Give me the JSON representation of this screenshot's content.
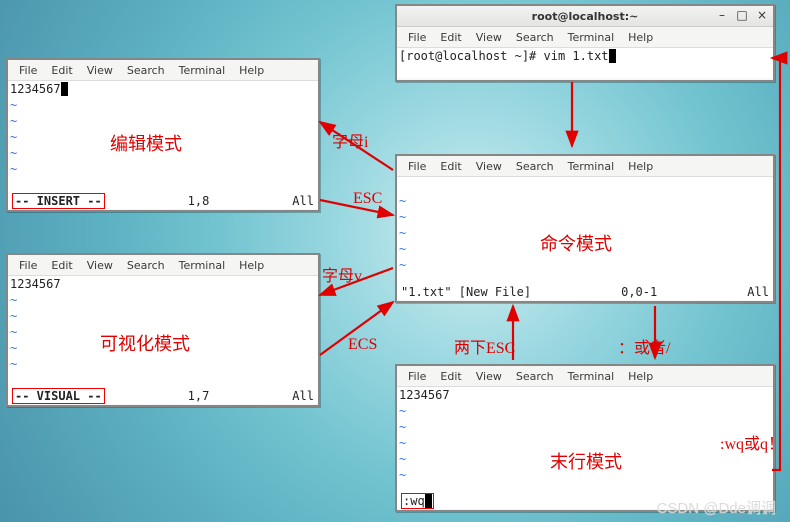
{
  "menu": {
    "file": "File",
    "edit": "Edit",
    "view": "View",
    "search": "Search",
    "terminal": "Terminal",
    "help": "Help"
  },
  "top": {
    "title": "root@localhost:~",
    "prompt": "[root@localhost ~]# vim 1.txt"
  },
  "edit": {
    "content": "1234567",
    "mode": "-- INSERT --",
    "pos": "1,8",
    "scroll": "All",
    "mode_label": "编辑模式"
  },
  "visual": {
    "content": "1234567",
    "mode": "-- VISUAL --",
    "pos": "1,7",
    "scroll": "All",
    "mode_label": "可视化模式"
  },
  "cmd": {
    "status_l": "\"1.txt\" [New File]",
    "status_c": "0,0-1",
    "status_r": "All",
    "mode_label": "命令模式"
  },
  "last": {
    "content": "1234567",
    "cmdline": ":wq",
    "mode_label": "末行模式"
  },
  "labels": {
    "letter_i": "字母i",
    "esc1": "ESC",
    "letter_v": "字母v",
    "ecs": "ECS",
    "two_esc": "两下ESC",
    "colon_or_slash": "：或者/",
    "wq_or_q": ":wq或q！"
  },
  "watermark": "CSDN @Dde调调"
}
